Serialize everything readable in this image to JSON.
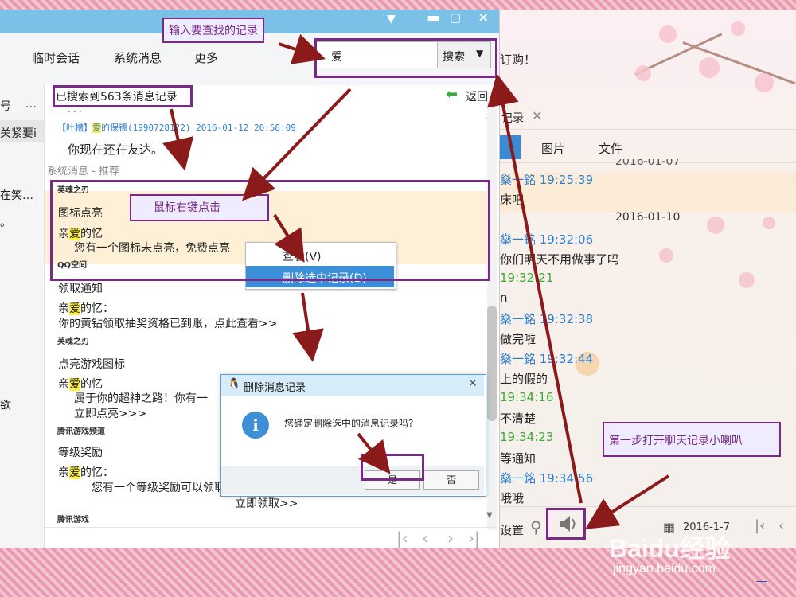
{
  "left_window": {
    "menu_tabs": [
      "临时会话",
      "系统消息",
      "更多"
    ],
    "search_value": "爱",
    "search_button": "搜索",
    "result_count": "已搜索到563条消息记录",
    "back_label": "返回",
    "dots": "· · ·",
    "sidebar_items": [
      "号",
      "…",
      "关紧要i",
      "在笑…",
      "。",
      "欲"
    ],
    "first_result": {
      "meta_prefix": "【吐槽】",
      "meta_highlight": "爱",
      "meta_rest": "的保镖(19907281?2) 2016-01-12 20:58:09",
      "text": "你现在还在友达。"
    },
    "section_header": "系统消息 - 推荐",
    "blocks": [
      {
        "source": "英魂之刃",
        "title": "图标点亮",
        "greeting_pre": "亲",
        "greeting_hl": "爱",
        "greeting_post": "的忆",
        "body": "您有一个图标未点亮，免费点亮"
      },
      {
        "source": "QQ空间",
        "title": "领取通知",
        "greeting_pre": "亲",
        "greeting_hl": "爱",
        "greeting_post": "的忆：",
        "body": "你的黄钻领取抽奖资格已到账，点此查看>>"
      },
      {
        "source": "英魂之刃",
        "title": "点亮游戏图标",
        "greeting_pre": "亲",
        "greeting_hl": "爱",
        "greeting_post": "的忆",
        "body": "属于你的超神之路！你有一",
        "body2": "立即点亮>>>"
      },
      {
        "source": "腾讯游戏频道",
        "title": "等级奖励",
        "greeting_pre": "亲",
        "greeting_hl": "爱",
        "greeting_post": "的忆：",
        "body": "您有一个等级奖励可以领取！",
        "body2": "立即领取>>"
      },
      {
        "source": "腾讯游戏"
      }
    ],
    "context_menu": [
      "查看(V)",
      "删除选中记录(D)"
    ],
    "dialog": {
      "title": "删除消息记录",
      "message": "您确定删除选中的消息记录吗?",
      "yes": "是",
      "no": "否"
    }
  },
  "right_window": {
    "top_text": "订购！",
    "tab_label": "记录",
    "media_tabs": [
      "图片",
      "文件"
    ],
    "date_partial": "2016-01-07",
    "messages": [
      {
        "type": "name",
        "text": "燊一銘 19:25:39"
      },
      {
        "type": "text",
        "text": "床吧"
      },
      {
        "type": "date",
        "text": "2016-01-10"
      },
      {
        "type": "name",
        "text": "燊一銘 19:32:06"
      },
      {
        "type": "text",
        "text": "你们明天不用做事了吗"
      },
      {
        "type": "green",
        "text": "19:32:21"
      },
      {
        "type": "text",
        "text": "n"
      },
      {
        "type": "name",
        "text": "燊一銘 19:32:38"
      },
      {
        "type": "text",
        "text": "做完啦"
      },
      {
        "type": "name",
        "text": "燊一銘 19:32:44"
      },
      {
        "type": "text",
        "text": "上的假的"
      },
      {
        "type": "green",
        "text": "19:34:16"
      },
      {
        "type": "text",
        "text": "不清楚"
      },
      {
        "type": "green",
        "text": "19:34:23"
      },
      {
        "type": "text",
        "text": "等通知"
      },
      {
        "type": "name",
        "text": "燊一銘 19:34:56"
      },
      {
        "type": "text",
        "text": "哦哦"
      }
    ],
    "bottom_left": "设置",
    "bottom_date": "2016-1-7",
    "speaker_icon": "speaker-icon"
  },
  "annotations": {
    "search_hint": "输入要查找的记录",
    "right_click_hint": "鼠标右键点击",
    "first_step": "第一步打开聊天记录小喇叭"
  },
  "watermark": {
    "brand": "Baidu经验",
    "url": "jingyan.baidu.com"
  },
  "colors": {
    "titlebar": "#7bc0e6",
    "annotation": "#7a2a86",
    "arrow": "#8b1a1a",
    "highlight": "#ffee44",
    "blue_text": "#2d7fd0"
  }
}
